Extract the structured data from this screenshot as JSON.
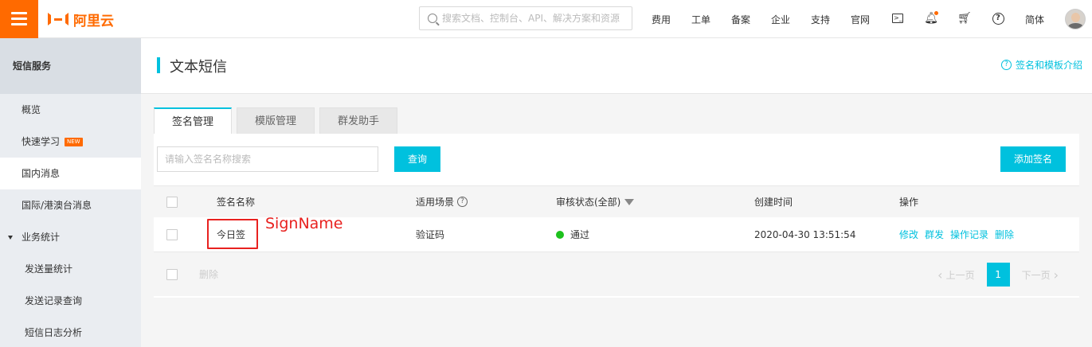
{
  "topbar": {
    "logo_text": "阿里云",
    "search_placeholder": "搜索文档、控制台、API、解决方案和资源",
    "nav": [
      "费用",
      "工单",
      "备案",
      "企业",
      "支持",
      "官网"
    ],
    "lang": "简体"
  },
  "sidebar": {
    "header": "短信服务",
    "items": [
      {
        "label": "概览"
      },
      {
        "label": "快速学习",
        "badge": "NEW"
      },
      {
        "label": "国内消息"
      },
      {
        "label": "国际/港澳台消息"
      },
      {
        "label": "业务统计"
      },
      {
        "label": "发送量统计"
      },
      {
        "label": "发送记录查询"
      },
      {
        "label": "短信日志分析"
      }
    ]
  },
  "page": {
    "title": "文本短信",
    "help_link": "签名和模板介绍"
  },
  "tabs": [
    "签名管理",
    "模版管理",
    "群发助手"
  ],
  "toolbar": {
    "search_placeholder": "请输入签名名称搜索",
    "query_button": "查询",
    "add_button": "添加签名"
  },
  "table": {
    "headers": {
      "name": "签名名称",
      "scene": "适用场景",
      "status": "审核状态(全部)",
      "created": "创建时间",
      "actions": "操作"
    },
    "rows": [
      {
        "name": "今日签",
        "scene": "验证码",
        "status": "通过",
        "created": "2020-04-30 13:51:54",
        "actions": [
          "修改",
          "群发",
          "操作记录",
          "删除"
        ]
      }
    ],
    "footer_delete": "删除"
  },
  "pagination": {
    "prev": "上一页",
    "current": "1",
    "next": "下一页"
  },
  "annotation": {
    "text": "SignName",
    "color": "#e8211f"
  },
  "colors": {
    "brand": "#ff6a00",
    "accent": "#00c1de",
    "status_ok": "#1dc11d"
  }
}
